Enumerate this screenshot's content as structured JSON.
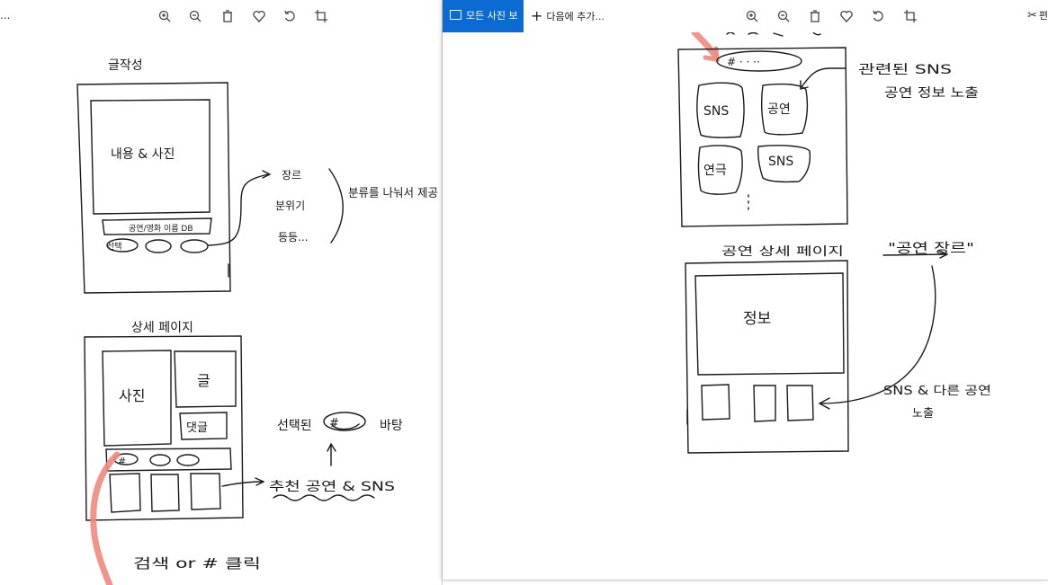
{
  "left_window": {
    "overflow_text": "...",
    "toolbar_icons": [
      "zoom-in-icon",
      "zoom-out-icon",
      "delete-icon",
      "favorite-icon",
      "rotate-icon",
      "crop-icon"
    ],
    "sketch": {
      "write_title": "글작성",
      "content_photo": "내용 & 사진",
      "db_bar": "공연/영화 이름 DB",
      "select_pill": "선택",
      "categories": [
        "장르",
        "분위기",
        "등등..."
      ],
      "categorize_note": "분류를 나눠서 제공",
      "detail_title": "상세 페이지",
      "photo": "사진",
      "text": "글",
      "comment": "댓글",
      "hash": "#",
      "selected_hash_note_a": "선택된",
      "selected_hash_note_b": "바탕",
      "recommend_note": "추천 공연 & SNS",
      "search_note": "검색 or # 클릭"
    }
  },
  "right_window": {
    "see_all_photos": "모든 사진 보기",
    "add_to": "다음에 추가...",
    "edit_label": "편",
    "toolbar_icons": [
      "zoom-in-icon",
      "zoom-out-icon",
      "delete-icon",
      "favorite-icon",
      "rotate-icon",
      "crop-icon"
    ],
    "sketch": {
      "hash_bar": "# · · ··",
      "related_note_a": "관련된 SNS",
      "related_note_b": "공연 정보 노출",
      "tiles": [
        "SNS",
        "공연",
        "연극",
        "SNS"
      ],
      "detail_title": "공연 상세 페이지",
      "genre_note": "\"공연 장르\"",
      "info": "정보",
      "expose_note_a": "SNS & 다른 공연",
      "expose_note_b": "노출"
    }
  },
  "colors": {
    "accent": "#0b6bd3",
    "ink": "#1a1a1a",
    "highlight": "#f08a7e"
  }
}
